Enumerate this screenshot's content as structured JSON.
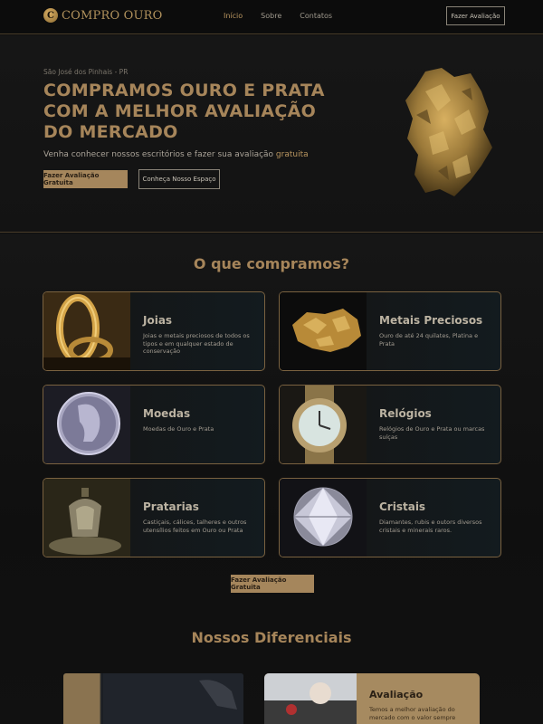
{
  "brand": {
    "logo_letter": "C",
    "name": "COMPRO OURO"
  },
  "nav": {
    "links": [
      "Início",
      "Sobre",
      "Contatos"
    ],
    "cta": "Fazer Avaliação"
  },
  "hero": {
    "location": "São José dos Pinhais - PR",
    "title_lines": [
      "COMPRAMOS OURO E PRATA",
      "COM A MELHOR AVALIAÇÃO",
      "DO MERCADO"
    ],
    "subtitle_prefix": "Venha conhecer nossos escritórios e fazer sua avaliação ",
    "subtitle_highlight": "gratuita",
    "primary_button": "Fazer Avaliação Gratuita",
    "secondary_button": "Conheça Nosso Espaço",
    "image_icon": "gold-nugget-icon"
  },
  "what_we_buy": {
    "title": "O que compramos?",
    "cards": [
      {
        "title": "Joias",
        "desc": "Joias e metais preciosos de todos os tipos e em qualquer estado de conservação",
        "icon": "gold-ring-icon"
      },
      {
        "title": "Metais Preciosos",
        "desc": "Ouro de até 24 quilates, Platina e Prata",
        "icon": "gold-ore-icon"
      },
      {
        "title": "Moedas",
        "desc": "Moedas de Ouro e Prata",
        "icon": "silver-coin-icon"
      },
      {
        "title": "Relógios",
        "desc": "Relógios de Ouro e Prata ou marcas suíças",
        "icon": "watch-icon"
      },
      {
        "title": "Pratarias",
        "desc": "Castiçais, cálices, talheres e outros utensílios feitos em Ouro ou Prata",
        "icon": "silverware-icon"
      },
      {
        "title": "Cristais",
        "desc": "Diamantes, rubis e outors diversos cristais e minerais raros.",
        "icon": "diamond-icon"
      }
    ],
    "cta": "Fazer Avaliação Gratuita"
  },
  "differentials": {
    "title": "Nossos Diferenciais",
    "right_card": {
      "title": "Avaliação",
      "desc": "Temos a melhor avaliação do mercado com o valor sempre"
    }
  },
  "colors": {
    "gold": "#a6855a",
    "background": "#0e0e0e",
    "border": "#7a6240"
  }
}
